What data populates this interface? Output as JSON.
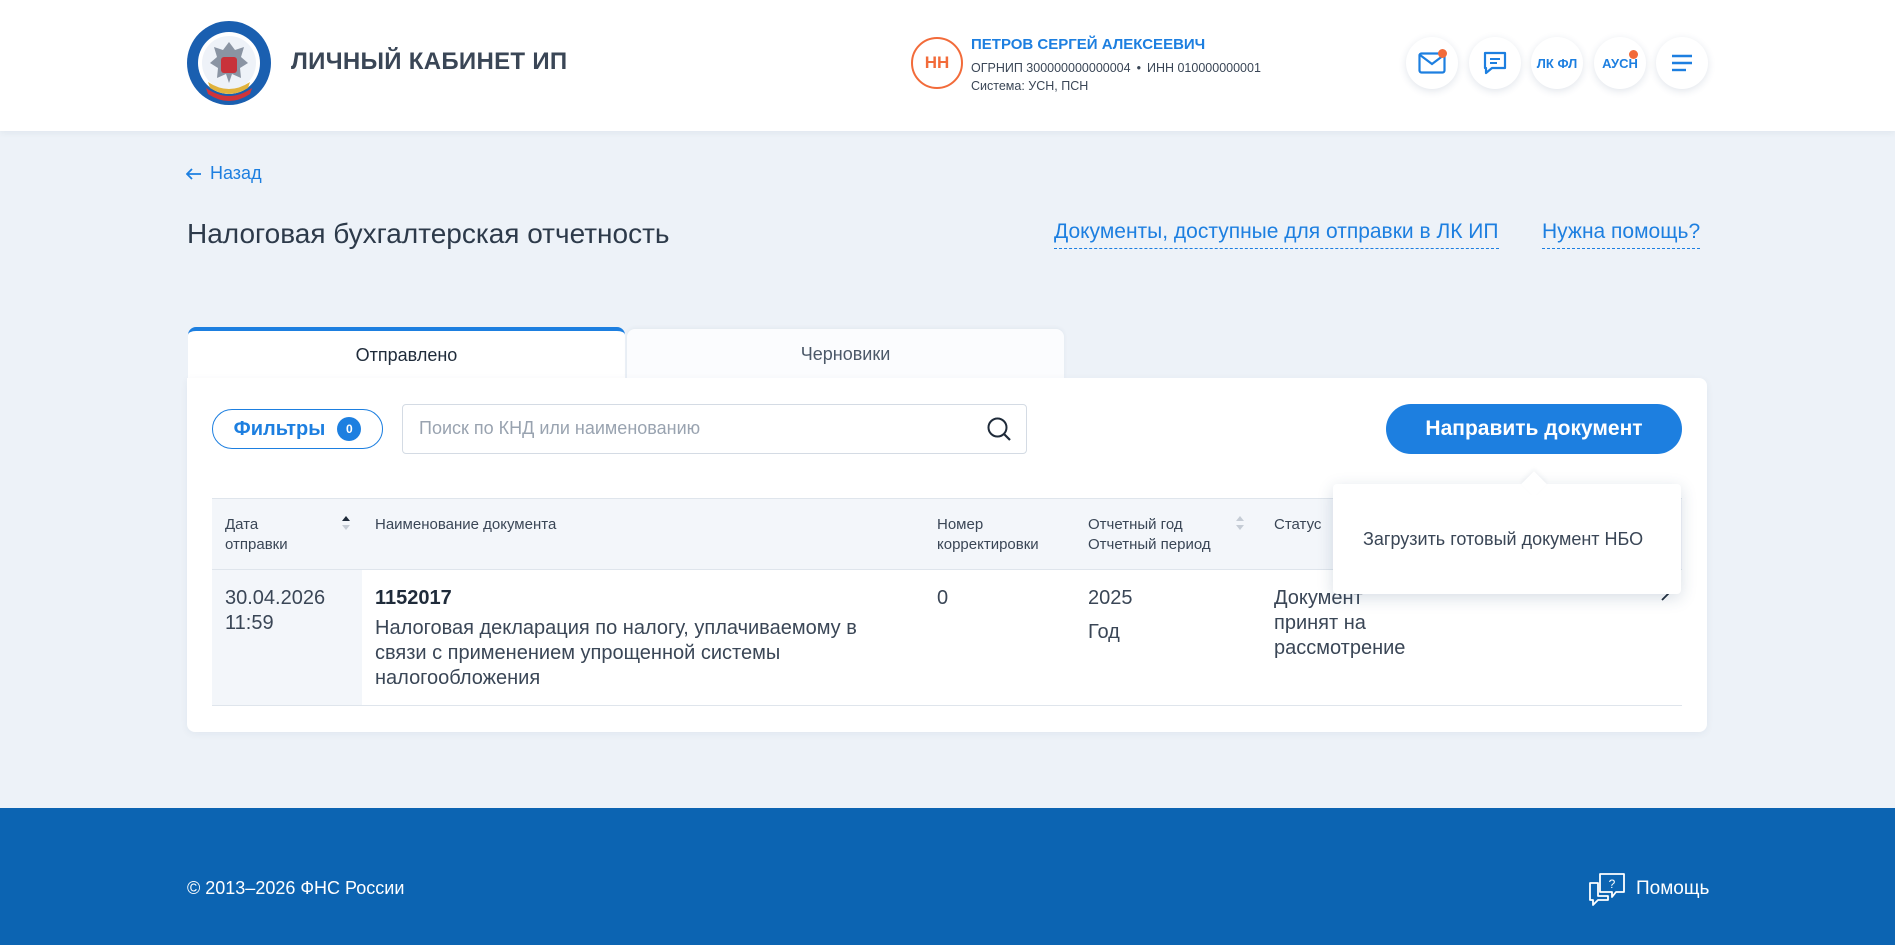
{
  "header": {
    "app_title": "ЛИЧНЫЙ КАБИНЕТ ИП",
    "user": {
      "initials": "НН",
      "name": "ПЕТРОВ СЕРГЕЙ АЛЕКСЕЕВИЧ",
      "ogrnip": "ОГРНИП 300000000000004",
      "inn": "ИНН 010000000001",
      "separator": "•",
      "system": "Система: УСН, ПСН"
    },
    "buttons": {
      "lk_fl": "ЛК ФЛ",
      "ausn": "АУСН"
    },
    "colors": {
      "accent": "#1d7fe0",
      "notification": "#f26b3a"
    }
  },
  "nav": {
    "back_label": "Назад"
  },
  "page": {
    "title": "Налоговая бухгалтерская отчетность",
    "docs_link": "Документы, доступные для отправки в ЛК ИП",
    "help_link": "Нужна помощь?"
  },
  "tabs": [
    {
      "label": "Отправлено",
      "active": true
    },
    {
      "label": "Черновики",
      "active": false
    }
  ],
  "toolbar": {
    "filters_label": "Фильтры",
    "filters_count": "0",
    "search_placeholder": "Поиск по КНД или наименованию",
    "search_value": "",
    "send_label": "Направить документ"
  },
  "dropdown": {
    "item": "Загрузить готовый документ НБО"
  },
  "table": {
    "columns": {
      "date_line1": "Дата",
      "date_line2": "отправки",
      "name": "Наименование документа",
      "corr_line1": "Номер",
      "corr_line2": "корректировки",
      "year_line1": "Отчетный год",
      "year_line2": "Отчетный период",
      "status": "Статус"
    },
    "rows": [
      {
        "date": "30.04.2026",
        "time": "11:59",
        "knd": "1152017",
        "name_line1": "Налоговая декларация по налогу, уплачиваемому в",
        "name_line2": "связи с применением упрощенной системы",
        "name_line3": "налогообложения",
        "correction": "0",
        "year": "2025",
        "period": "Год",
        "status_line1": "Документ",
        "status_line2": "принят на",
        "status_line3": "рассмотрение"
      }
    ]
  },
  "footer": {
    "copyright": "© 2013–2026 ФНС России",
    "help": "Помощь"
  }
}
